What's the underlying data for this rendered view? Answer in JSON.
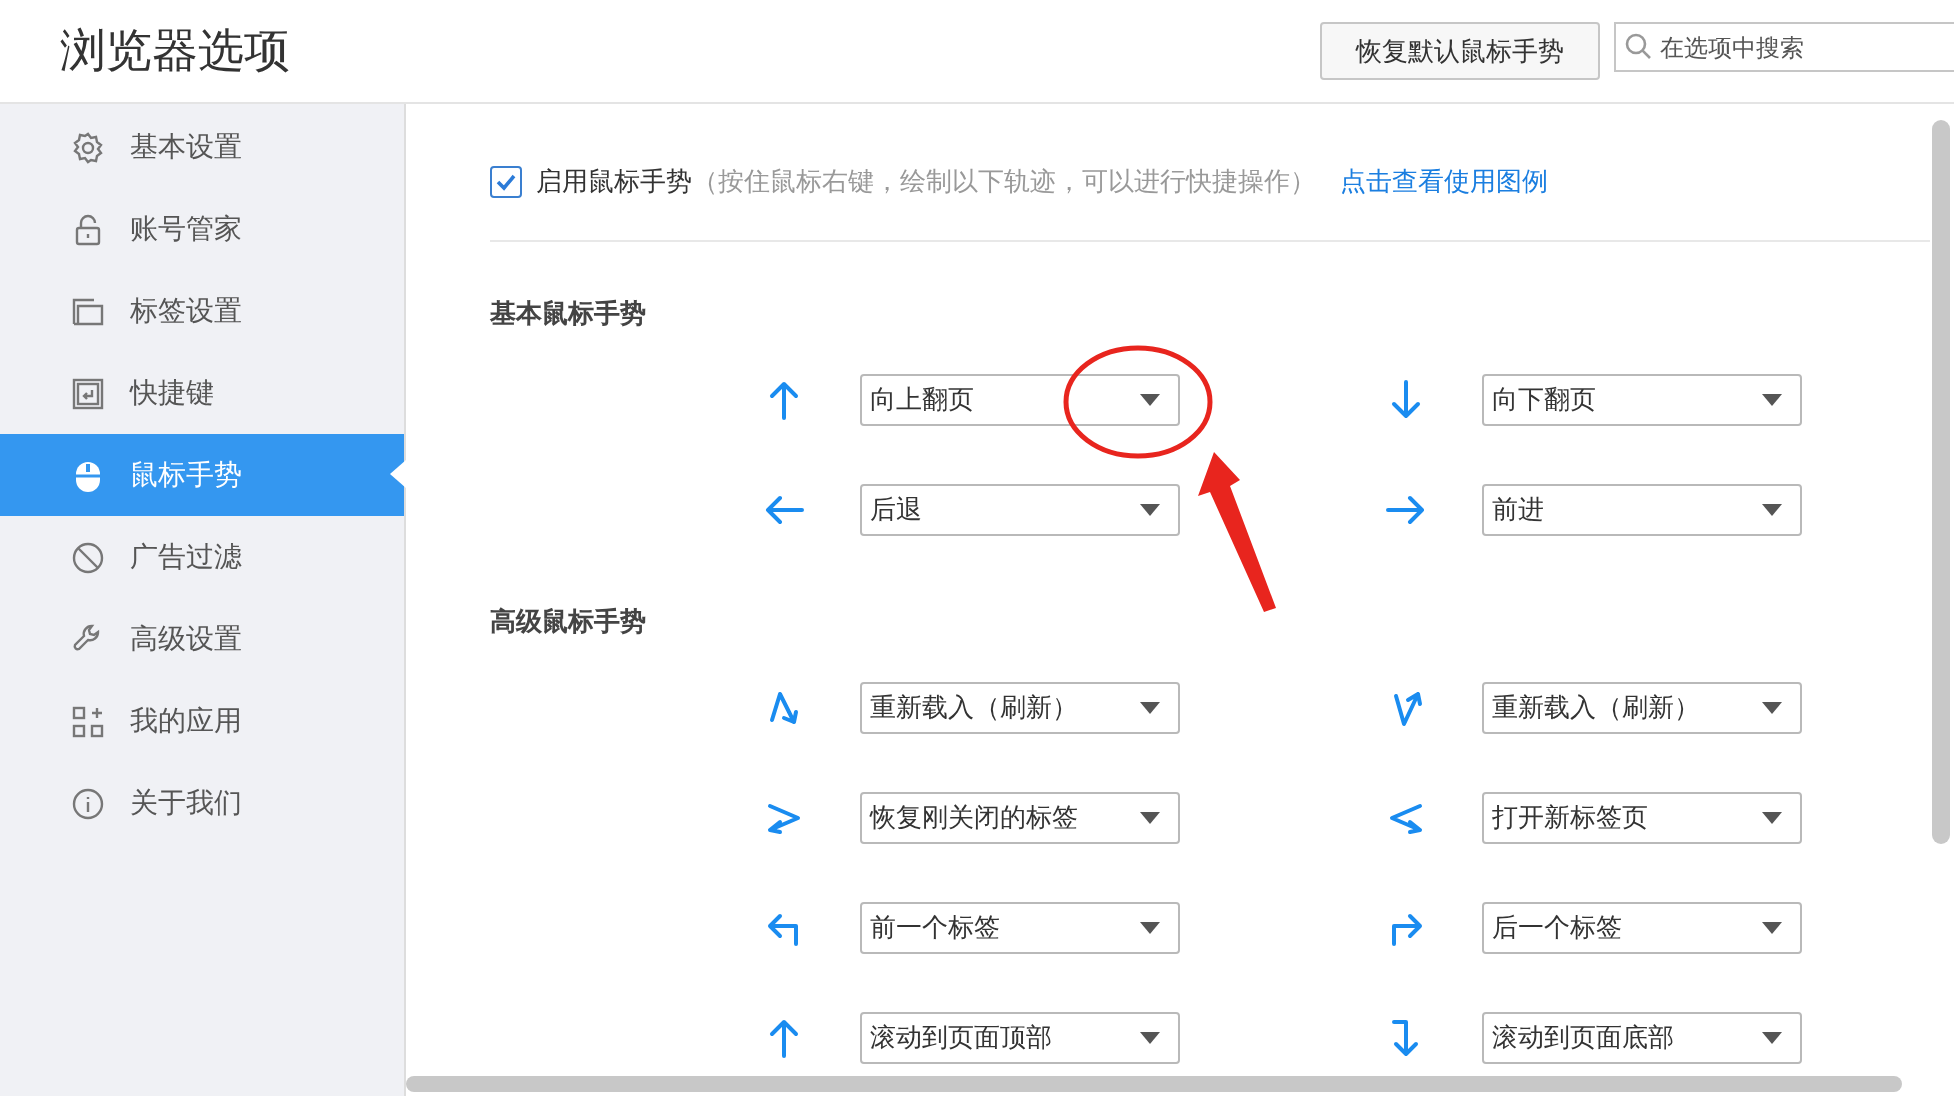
{
  "window": {
    "title": "浏览器选项"
  },
  "header": {
    "reset_button": "恢复默认鼠标手势",
    "search": {
      "placeholder": "在选项中搜索"
    }
  },
  "sidebar": {
    "items": [
      {
        "label": "基本设置",
        "kind": "gear",
        "selected": false
      },
      {
        "label": "账号管家",
        "kind": "lock",
        "selected": false
      },
      {
        "label": "标签设置",
        "kind": "tabs",
        "selected": false
      },
      {
        "label": "快捷键",
        "kind": "key",
        "selected": false
      },
      {
        "label": "鼠标手势",
        "kind": "mouse",
        "selected": true
      },
      {
        "label": "广告过滤",
        "kind": "block",
        "selected": false
      },
      {
        "label": "高级设置",
        "kind": "wrench",
        "selected": false
      },
      {
        "label": "我的应用",
        "kind": "apps",
        "selected": false
      },
      {
        "label": "关于我们",
        "kind": "info",
        "selected": false
      }
    ]
  },
  "enable": {
    "label": "启用鼠标手势",
    "hint": "（按住鼠标右键，绘制以下轨迹，可以进行快捷操作）",
    "checked": true,
    "link": "点击查看使用图例"
  },
  "sections": [
    {
      "title": "基本鼠标手势",
      "gestures": [
        {
          "kind": "up",
          "action": "向上翻页"
        },
        {
          "kind": "down",
          "action": "向下翻页"
        },
        {
          "kind": "left",
          "action": "后退"
        },
        {
          "kind": "right",
          "action": "前进"
        }
      ]
    },
    {
      "title": "高级鼠标手势",
      "gestures": [
        {
          "kind": "zigzag-down",
          "action": "重新载入（刷新）"
        },
        {
          "kind": "zigzag-up",
          "action": "重新载入（刷新）"
        },
        {
          "kind": "angle-right",
          "action": "恢复刚关闭的标签"
        },
        {
          "kind": "angle-left",
          "action": "打开新标签页"
        },
        {
          "kind": "hook-left",
          "action": "前一个标签"
        },
        {
          "kind": "hook-right",
          "action": "后一个标签"
        },
        {
          "kind": "up",
          "action": "滚动到页面顶部"
        },
        {
          "kind": "hook-down",
          "action": "滚动到页面底部"
        }
      ]
    }
  ]
}
